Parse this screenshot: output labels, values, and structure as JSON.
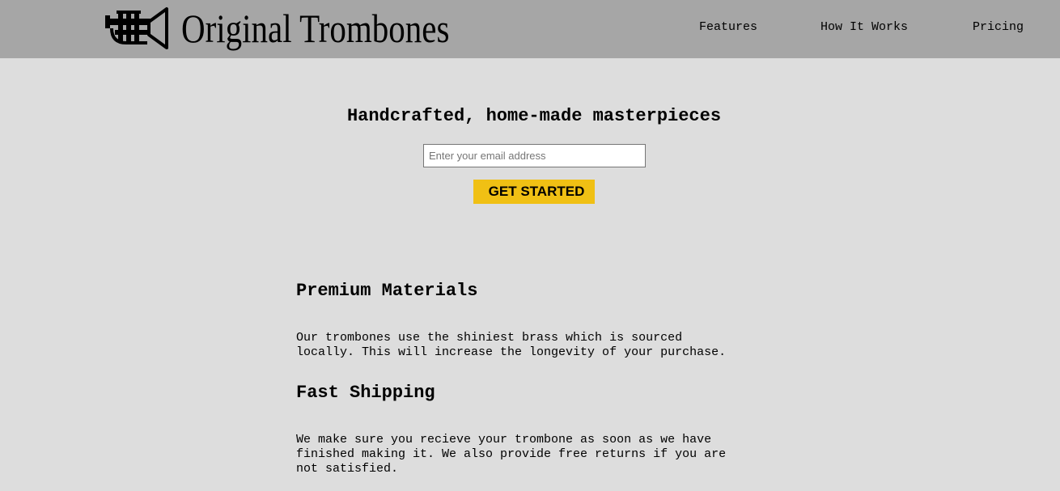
{
  "header": {
    "brand": "Original Trombones",
    "logo_icon": "trumpet-icon",
    "nav": [
      {
        "label": "Features"
      },
      {
        "label": "How It Works"
      },
      {
        "label": "Pricing"
      }
    ],
    "background": "#a6a6a6"
  },
  "hero": {
    "title": "Handcrafted, home-made masterpieces",
    "email_placeholder": "Enter your email address",
    "email_value": "",
    "cta_label": "GET STARTED",
    "cta_color": "#f0c014"
  },
  "features": [
    {
      "title": "Premium Materials",
      "text": "Our trombones use the shiniest brass which is sourced\nlocally. This will increase the longevity of your purchase."
    },
    {
      "title": "Fast Shipping",
      "text": "We make sure you recieve your trombone as soon as we have\nfinished making it. We also provide free returns if you are\nnot satisfied."
    }
  ],
  "page_background": "#dddddd"
}
